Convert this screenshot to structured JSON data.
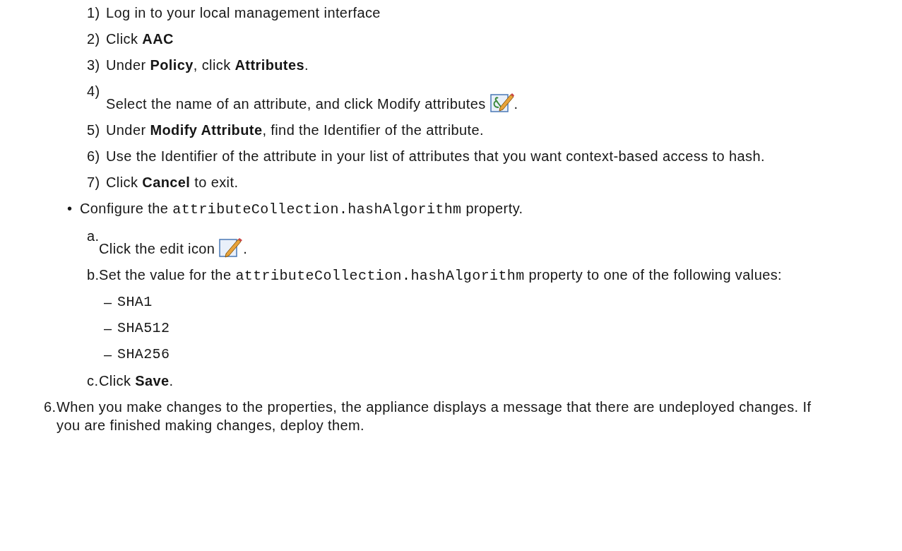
{
  "substeps": [
    {
      "marker": "1)",
      "text": "Log in to your local management interface"
    },
    {
      "marker": "2)",
      "text": "Click **AAC**"
    },
    {
      "marker": "3)",
      "text": "Under **Policy**, click **Attributes**."
    },
    {
      "marker": "4)",
      "text": "Select the name of an attribute, and click Modify attributes",
      "kind": "inline_icon",
      "after": "."
    },
    {
      "marker": "5)",
      "text": "Under **Modify Attribute**, find the Identifier of the attribute."
    },
    {
      "marker": "6)",
      "text": "Use the Identifier of the attribute in your list of attributes that you want context-based access to hash."
    },
    {
      "marker": "7)",
      "text": "Click **Cancel** to exit."
    }
  ],
  "bullet": {
    "marker": "•",
    "parts": [
      {
        "kind": "text",
        "text": "Configure the "
      },
      {
        "kind": "code",
        "text": "attributeCollection.hashAlgorithm"
      },
      {
        "kind": "text",
        "text": " property."
      }
    ]
  },
  "lettered": [
    {
      "marker": "a.",
      "parts": [
        {
          "kind": "text",
          "text": "Click the edit icon"
        }
      ],
      "kind": "inline_icon",
      "after": "."
    },
    {
      "marker": "b.",
      "parts": [
        {
          "kind": "text",
          "text": "Set the value for the "
        },
        {
          "kind": "code",
          "text": "attributeCollection.hashAlgorithm"
        },
        {
          "kind": "text",
          "text": " property to one of the following values:"
        }
      ],
      "values": [
        {
          "marker": "–",
          "text": "SHA1"
        },
        {
          "marker": "–",
          "text": "SHA512"
        },
        {
          "marker": "–",
          "text": "SHA256"
        }
      ]
    },
    {
      "marker": "c.",
      "parts": [
        {
          "kind": "rich",
          "text": "Click **Save**."
        }
      ]
    }
  ],
  "final_step": {
    "marker": "6.",
    "text": "When you make changes to the properties, the appliance displays a message that there are undeployed changes. If you are finished making changes, deploy them."
  }
}
